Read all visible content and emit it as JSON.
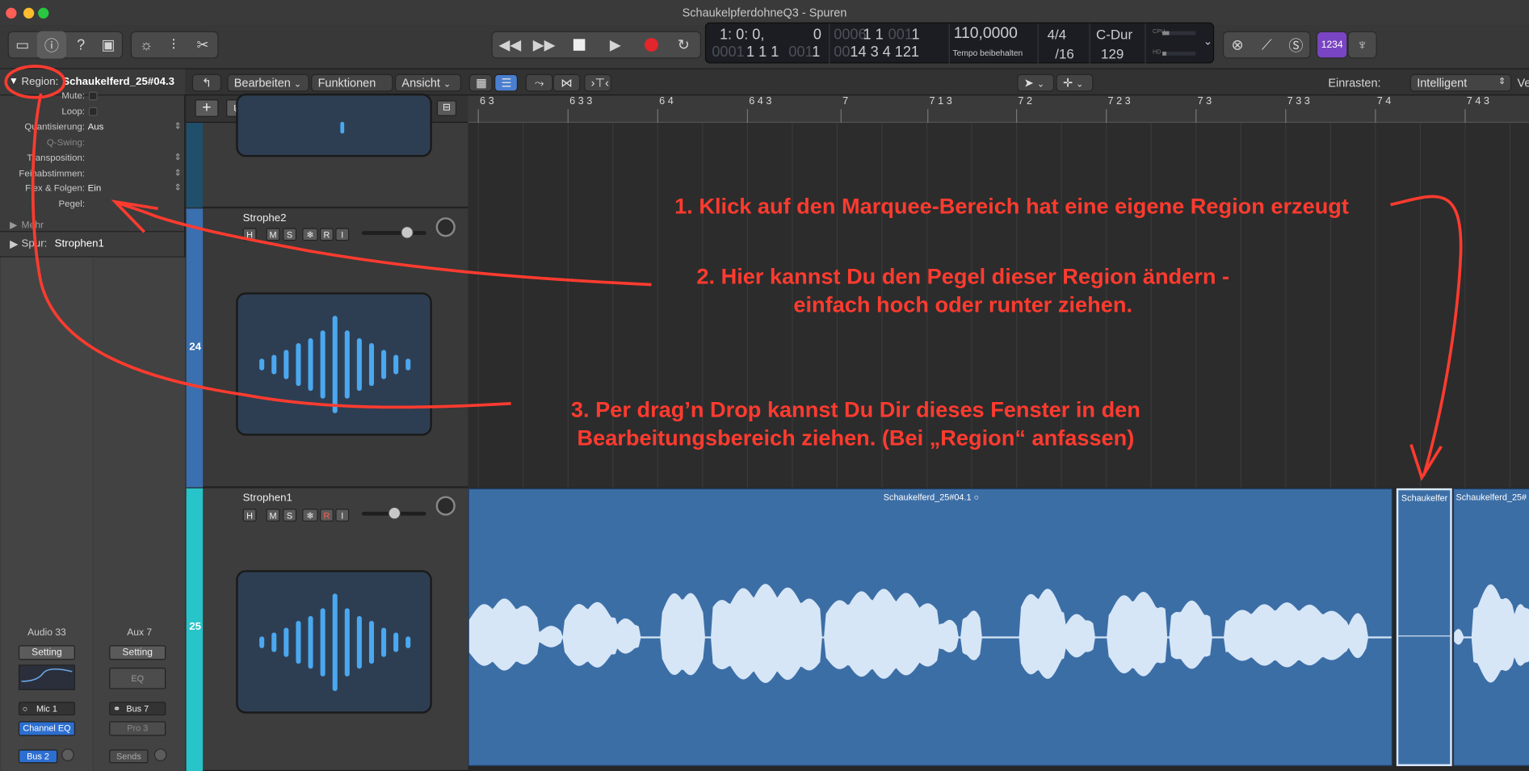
{
  "window": {
    "title": "SchaukelpferdohneQ3 - Spuren"
  },
  "lcd": {
    "pos_top": "1: 0: 0,",
    "pos_top2": "0",
    "pos_top_dim": "0006",
    "pos_top_mid": "1 1",
    "pos_top_dim2": "001",
    "pos_top_end": "1",
    "pos_bot_dim": "0001",
    "pos_bot": "1 1 1",
    "pos_bot_dim2": "001",
    "pos_bot2": "1",
    "pos_bot_dim3": "00",
    "pos_bot_mid": "14 3 4 121",
    "tempo": "110,0000",
    "tempo_label": "Tempo beibehalten",
    "sig_top": "4/4",
    "sig_bot": "/16",
    "key": "C-Dur",
    "key_bpm": "129",
    "cpu": "CPU",
    "hd": "HD"
  },
  "toolbar": {
    "count_in": "1234"
  },
  "ctrlbar": {
    "menus": [
      "Bearbeiten",
      "Funktionen",
      "Ansicht"
    ],
    "snap_label": "Einrasten:",
    "snap_value": "Intelligent",
    "more": "Ve"
  },
  "ruler": {
    "ticks": [
      "6 3",
      "6 3 3",
      "6 4",
      "6 4 3",
      "7",
      "7 1 3",
      "7 2",
      "7 2 3",
      "7 3",
      "7 3 3",
      "7 4",
      "7 4 3"
    ]
  },
  "inspector": {
    "region_label": "Region:",
    "region_name": "Schaukelferd_25#04.3",
    "rows": [
      {
        "label": "Mute:",
        "value": ""
      },
      {
        "label": "Loop:",
        "value": ""
      },
      {
        "label": "Quantisierung:",
        "value": "Aus"
      },
      {
        "label": "Q-Swing:",
        "value": ""
      },
      {
        "label": "Transposition:",
        "value": ""
      },
      {
        "label": "Feinabstimmen:",
        "value": ""
      },
      {
        "label": "Flex & Folgen:",
        "value": "Ein"
      },
      {
        "label": "Pegel:",
        "value": ""
      }
    ],
    "more": "Mehr",
    "spur_label": "Spur:",
    "spur_name": "Strophen1",
    "strip1": {
      "name": "Audio 33",
      "setting": "Setting",
      "input": "Mic 1",
      "eq": "Channel EQ",
      "out": "Bus 2"
    },
    "strip2": {
      "name": "Aux 7",
      "setting": "Setting",
      "eq": "EQ",
      "input": "Bus 7",
      "plugin": "Pro  3",
      "sends": "Sends"
    }
  },
  "tracks": [
    {
      "name": "Strophe2",
      "num": "24",
      "buttons": [
        "H",
        "M",
        "S",
        "❄",
        "R",
        "I"
      ]
    },
    {
      "name": "Strophen1",
      "num": "25",
      "buttons": [
        "H",
        "M",
        "S",
        "❄",
        "R",
        "I"
      ]
    }
  ],
  "regions": {
    "main": "Schaukelferd_25#04.1",
    "small": "Schaukelfer",
    "right": "Schaukelferd_25#"
  },
  "annotations": {
    "a1": "1. Klick auf den Marquee-Bereich hat eine eigene Region erzeugt",
    "a2_l1": "2. Hier kannst Du den Pegel dieser Region ändern -",
    "a2_l2": "einfach hoch oder runter ziehen.",
    "a3_l1": "3. Per drag’n Drop kannst Du Dir dieses Fenster in den",
    "a3_l2": "Bearbeitungsbereich ziehen. (Bei „Region“ anfassen)"
  },
  "colors": {
    "annotation": "#ff3b2f",
    "region": "#3c6ea6",
    "waveform": "#d6e6f7",
    "track25": "#27c4c9",
    "track24": "#3a6fb0"
  }
}
